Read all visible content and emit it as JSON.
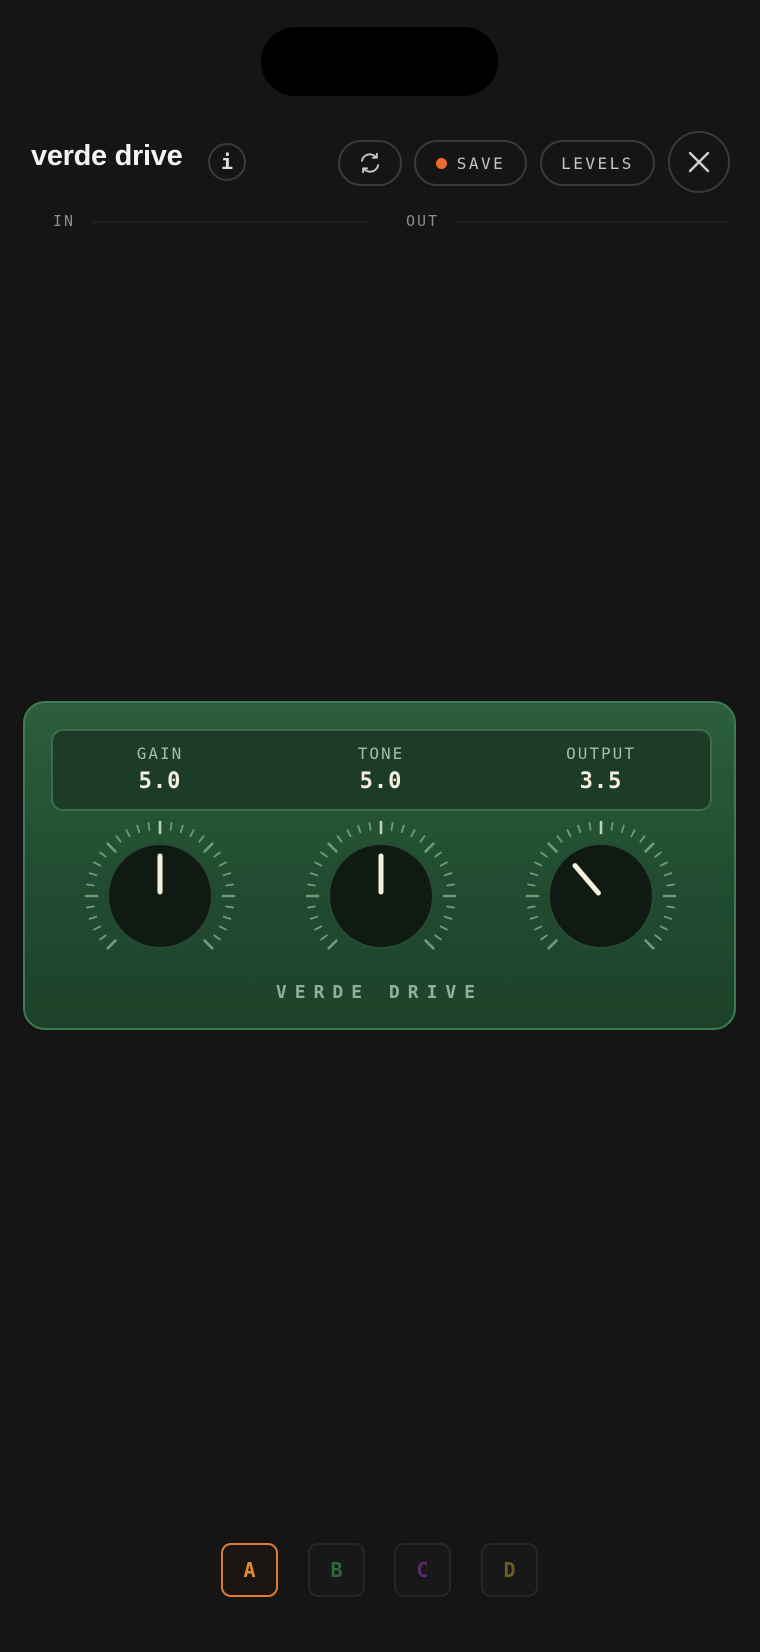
{
  "header": {
    "title": "verde drive",
    "info_label": "i",
    "refresh_icon": "refresh-icon",
    "save_label": "SAVE",
    "save_dot_color": "#ef6a2a",
    "levels_label": "LEVELS",
    "close_icon": "close-icon"
  },
  "meters": {
    "in_label": "IN",
    "out_label": "OUT"
  },
  "pedal": {
    "name": "VERDE DRIVE",
    "body_color": "#2a5a3a",
    "params": [
      {
        "label": "GAIN",
        "value": "5.0",
        "level": 0.5
      },
      {
        "label": "TONE",
        "value": "5.0",
        "level": 0.5
      },
      {
        "label": "OUTPUT",
        "value": "3.5",
        "level": 0.35
      }
    ]
  },
  "slots": [
    {
      "label": "A",
      "color": "#e58a32",
      "active": true
    },
    {
      "label": "B",
      "color": "#2e6a36",
      "active": false
    },
    {
      "label": "C",
      "color": "#5a2a6e",
      "active": false
    },
    {
      "label": "D",
      "color": "#6c5c24",
      "active": false
    }
  ]
}
